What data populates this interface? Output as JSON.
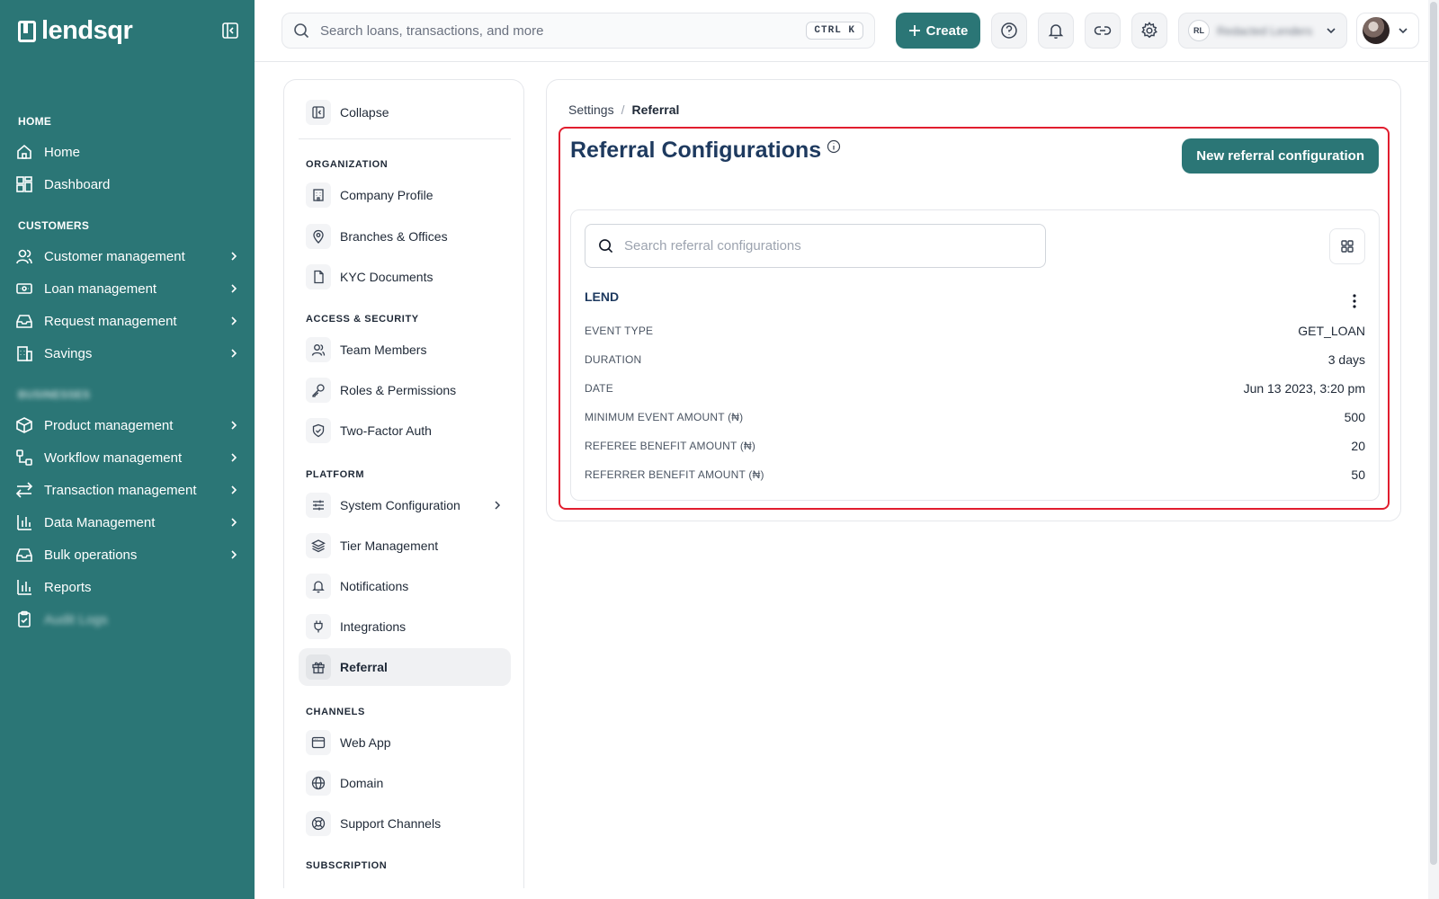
{
  "app": {
    "name": "lendsqr"
  },
  "sidebar": {
    "sections": {
      "home": "HOME",
      "customers": "CUSTOMERS",
      "hidden_section": "BUSINESSES"
    },
    "home": "Home",
    "dashboard": "Dashboard",
    "customer_management": "Customer management",
    "loan_management": "Loan management",
    "request_management": "Request management",
    "savings": "Savings",
    "product_management": "Product management",
    "workflow_management": "Workflow management",
    "transaction_management": "Transaction management",
    "data_management": "Data Management",
    "bulk_operations": "Bulk operations",
    "reports": "Reports",
    "hidden_item": "Audit Logs"
  },
  "topbar": {
    "search_placeholder": "Search loans, transactions, and more",
    "shortcut": "CTRL K",
    "create_label": "Create",
    "org_initials": "RL",
    "org_name": "Redacted Lenders"
  },
  "settings_nav": {
    "collapse": "Collapse",
    "sections": {
      "organization": "ORGANIZATION",
      "access_security": "ACCESS & SECURITY",
      "platform": "PLATFORM",
      "channels": "CHANNELS",
      "subscription": "SUBSCRIPTION"
    },
    "company_profile": "Company Profile",
    "branches_offices": "Branches & Offices",
    "kyc_documents": "KYC Documents",
    "team_members": "Team Members",
    "roles_permissions": "Roles & Permissions",
    "two_factor_auth": "Two-Factor Auth",
    "system_configuration": "System Configuration",
    "tier_management": "Tier Management",
    "notifications": "Notifications",
    "integrations": "Integrations",
    "referral": "Referral",
    "web_app": "Web App",
    "domain": "Domain",
    "support_channels": "Support Channels"
  },
  "main": {
    "breadcrumb": {
      "root": "Settings",
      "separator": "/",
      "current": "Referral"
    },
    "title": "Referral Configurations",
    "new_button": "New referral configuration",
    "search_placeholder": "Search referral configurations",
    "config": {
      "name": "LEND",
      "rows": [
        {
          "key": "EVENT TYPE",
          "value": "GET_LOAN"
        },
        {
          "key": "DURATION",
          "value": "3 days"
        },
        {
          "key": "DATE",
          "value": "Jun 13 2023, 3:20 pm"
        },
        {
          "key": "MINIMUM EVENT AMOUNT (₦)",
          "value": "500"
        },
        {
          "key": "REFEREE BENEFIT AMOUNT (₦)",
          "value": "20"
        },
        {
          "key": "REFERRER BENEFIT AMOUNT (₦)",
          "value": "50"
        }
      ]
    }
  },
  "colors": {
    "brand": "#2b7676",
    "highlight": "#e11d2e",
    "title": "#1e3a5f"
  }
}
